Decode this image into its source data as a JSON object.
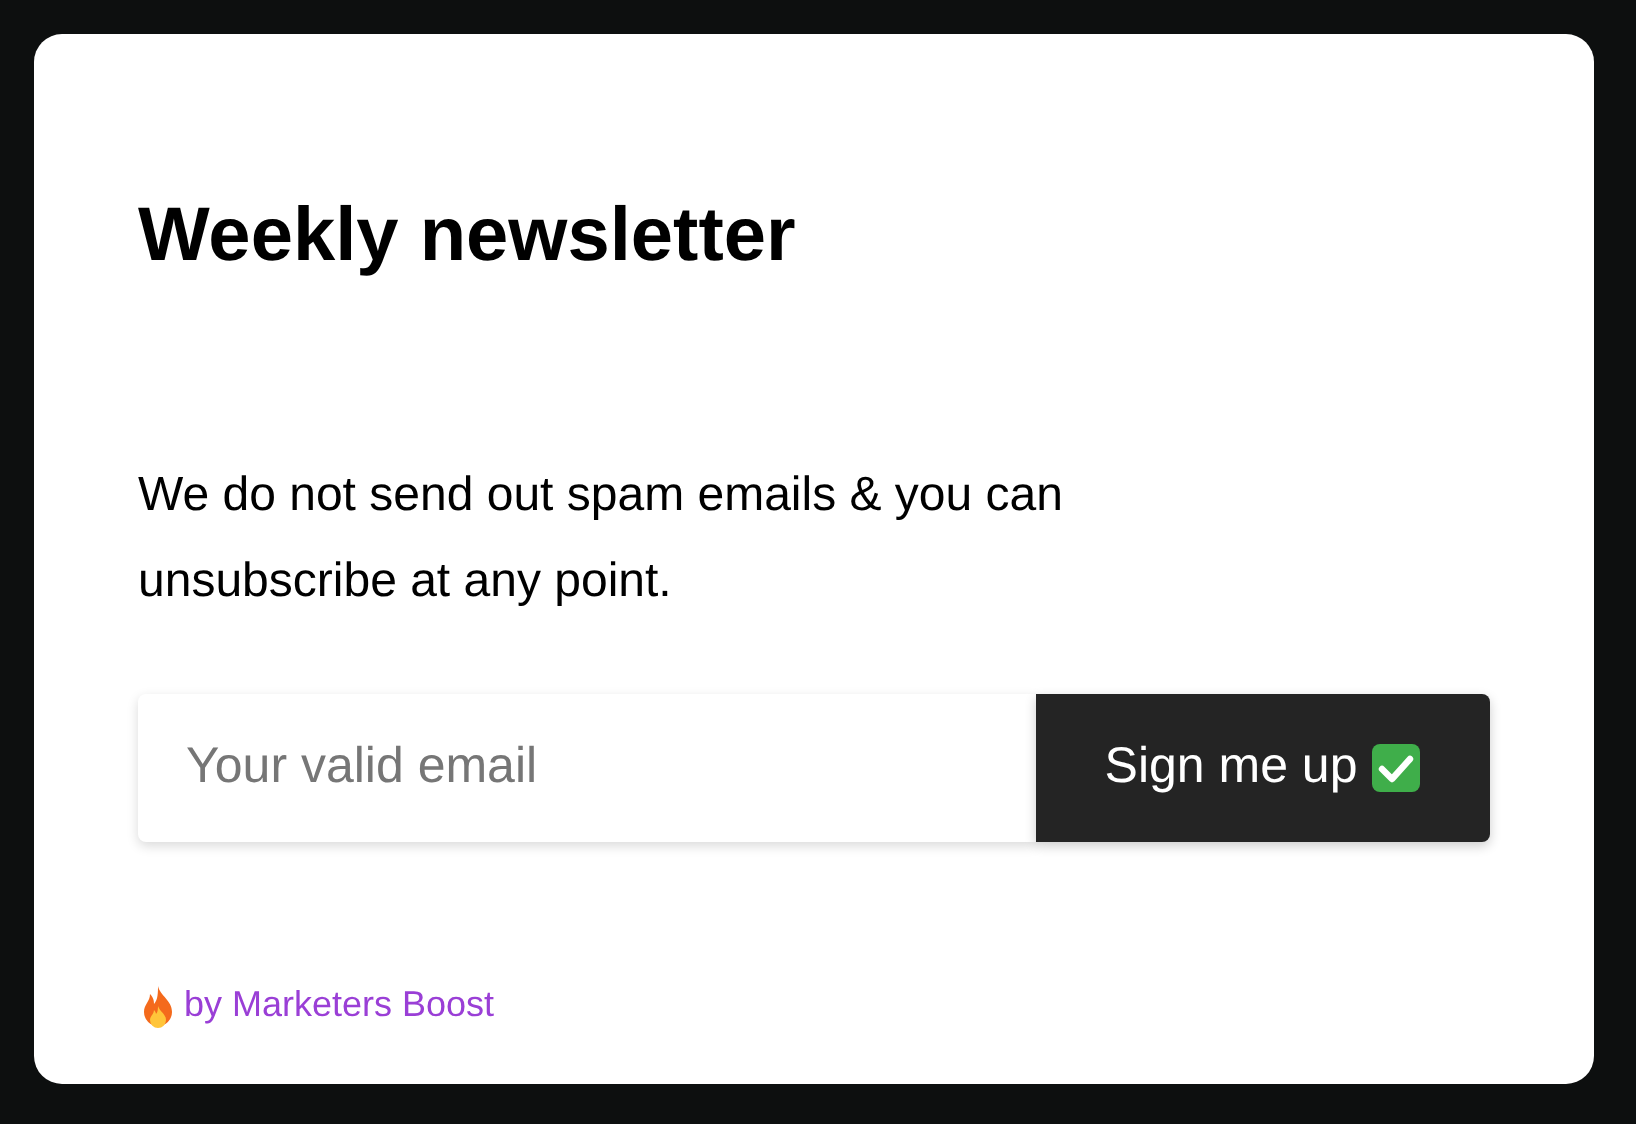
{
  "title": "Weekly newsletter",
  "description": "We do not send out spam emails & you can unsubscribe at any point.",
  "email_field": {
    "placeholder": "Your valid email"
  },
  "submit_button": {
    "label": "Sign me up"
  },
  "credit": {
    "label": "by Marketers Boost"
  }
}
